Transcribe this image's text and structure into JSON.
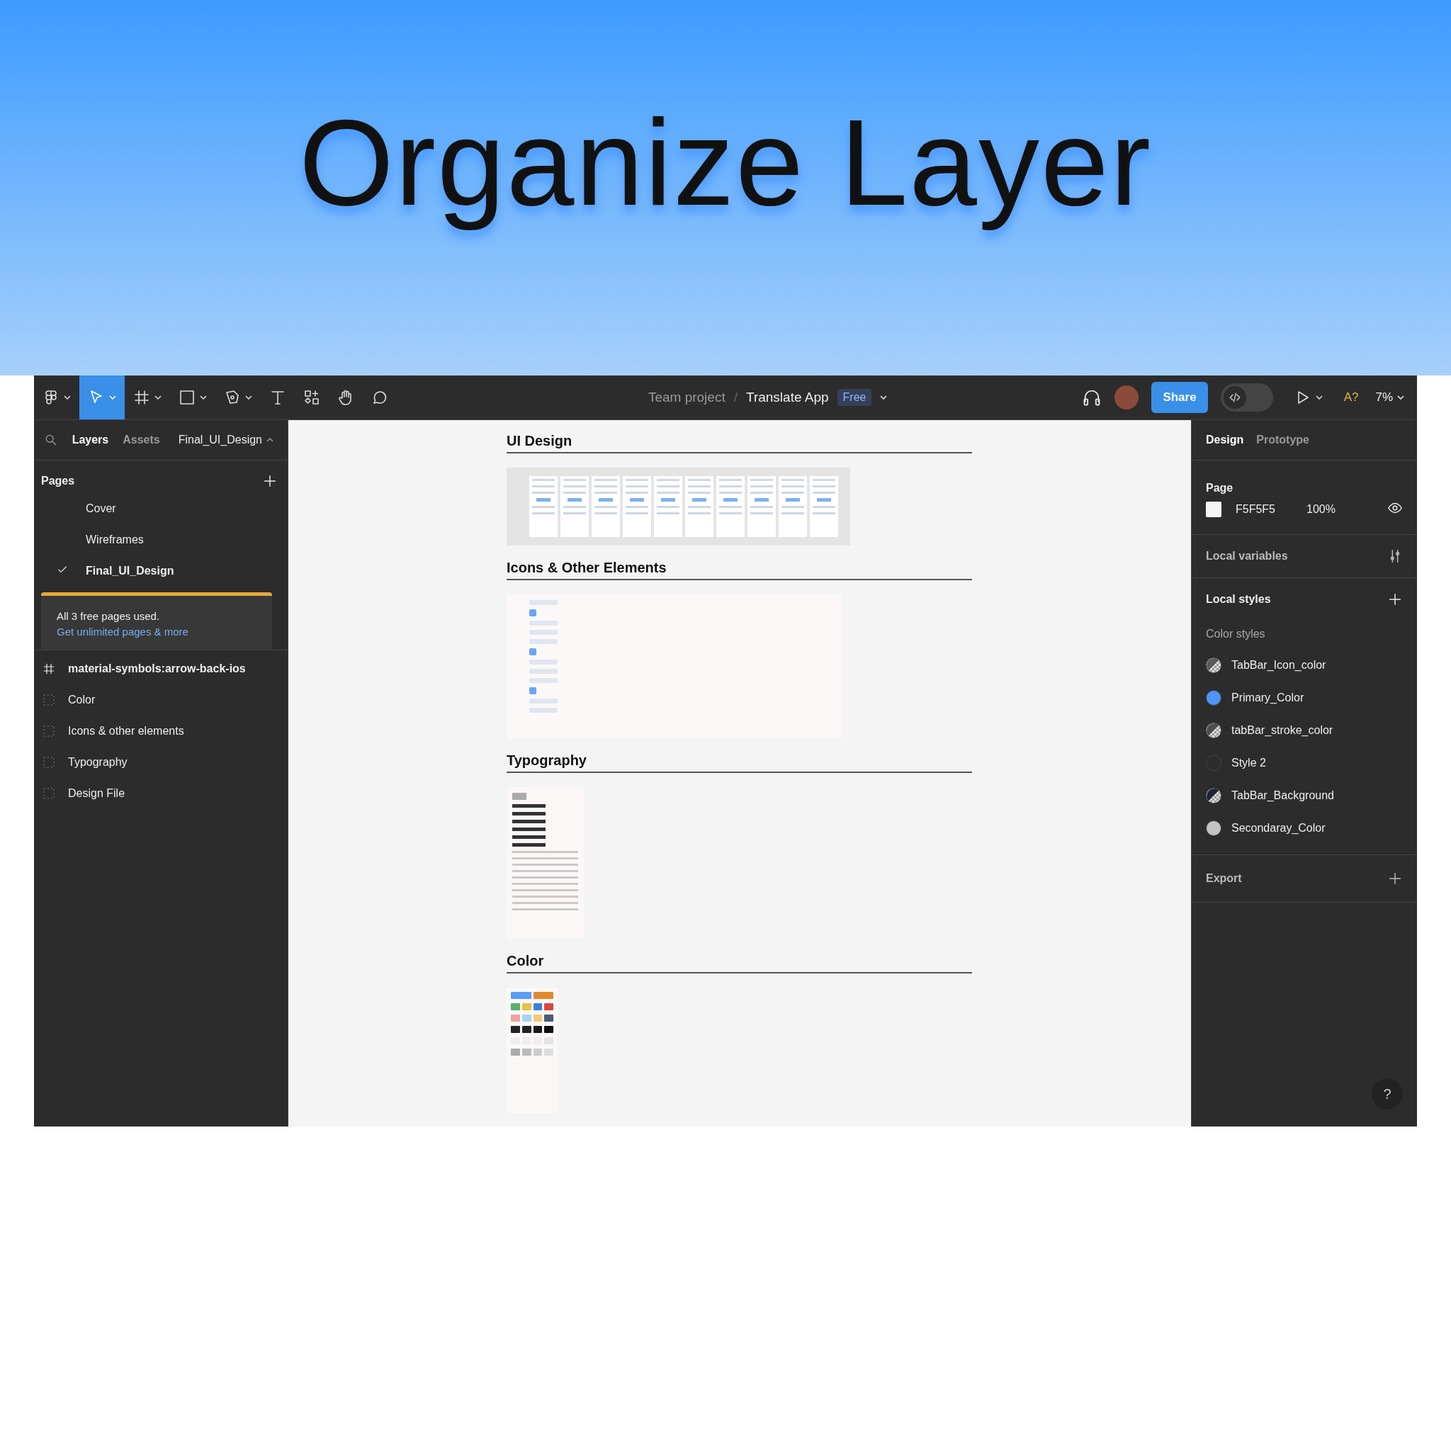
{
  "hero": {
    "title": "Organize Layer"
  },
  "toolbar": {
    "tools": [
      {
        "kind": "main-menu",
        "selected": false
      },
      {
        "kind": "move",
        "selected": true
      },
      {
        "kind": "frame",
        "selected": false
      },
      {
        "kind": "shape",
        "selected": false
      },
      {
        "kind": "pen",
        "selected": false
      },
      {
        "kind": "text",
        "selected": false
      },
      {
        "kind": "resources",
        "selected": false
      },
      {
        "kind": "hand",
        "selected": false
      },
      {
        "kind": "comment",
        "selected": false
      }
    ],
    "breadcrumb": {
      "team": "Team project",
      "separator": "/",
      "file": "Translate App",
      "plan_badge": "Free"
    },
    "share_button": "Share",
    "dev_mode_toggle": {
      "on": false
    },
    "font_warning": "A?",
    "zoom": "7%"
  },
  "left_panel": {
    "tabs": [
      {
        "label": "Layers",
        "selected": true
      },
      {
        "label": "Assets",
        "selected": false
      }
    ],
    "page_selector": "Final_UI_Design",
    "pages_heading": "Pages",
    "pages": [
      {
        "label": "Cover",
        "selected": false
      },
      {
        "label": "Wireframes",
        "selected": false
      },
      {
        "label": "Final_UI_Design",
        "selected": true
      }
    ],
    "banner": {
      "text": "All 3 free pages used.",
      "link": "Get unlimited pages & more"
    },
    "layers": [
      {
        "label": "material-symbols:arrow-back-ios",
        "kind": "frame"
      },
      {
        "label": "Color",
        "kind": "section"
      },
      {
        "label": "Icons & other elements",
        "kind": "section"
      },
      {
        "label": "Typography",
        "kind": "section"
      },
      {
        "label": "Design File",
        "kind": "section"
      }
    ]
  },
  "canvas": {
    "sections": [
      {
        "title": "UI Design",
        "kind": "screens"
      },
      {
        "title": "Icons & Other Elements",
        "kind": "icons"
      },
      {
        "title": "Typography",
        "kind": "typography"
      },
      {
        "title": "Color",
        "kind": "palette"
      }
    ]
  },
  "right_panel": {
    "tabs": [
      {
        "label": "Design",
        "selected": true
      },
      {
        "label": "Prototype",
        "selected": false
      }
    ],
    "page": {
      "heading": "Page",
      "fill_hex": "F5F5F5",
      "opacity": "100%"
    },
    "local_variables": "Local variables",
    "local_styles": "Local styles",
    "color_styles_heading": "Color styles",
    "color_styles": [
      {
        "name": "TabBar_Icon_color",
        "color": "#5a5a5a",
        "kind": "translucent"
      },
      {
        "name": "Primary_Color",
        "color": "#4f94f7",
        "kind": "solid"
      },
      {
        "name": "tabBar_stroke_color",
        "color": "#4e4e4e",
        "kind": "translucent"
      },
      {
        "name": "Style 2",
        "color": "#2c2c2c",
        "kind": "solid"
      },
      {
        "name": "TabBar_Background",
        "color": "#1e2633",
        "kind": "translucent"
      },
      {
        "name": "Secondaray_Color",
        "color": "#c4c4c4",
        "kind": "solid"
      }
    ],
    "export": "Export",
    "help": "?"
  }
}
